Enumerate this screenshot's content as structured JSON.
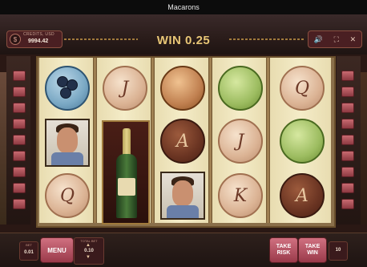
{
  "window": {
    "title": "Macarons"
  },
  "header": {
    "credits_label": "CREDITS, USD",
    "credits_value": "9994.42",
    "win_text": "WIN 0.25"
  },
  "settings": {
    "sound_icon": "sound-icon",
    "fullscreen_icon": "fullscreen-icon",
    "close_icon": "close-icon"
  },
  "reels": [
    [
      "macaron-blue-berry",
      "portrait-man",
      "macaron-cream-Q"
    ],
    [
      "macaron-cream-J",
      "champagne-bottle",
      "champagne-bottle"
    ],
    [
      "macaron-orange",
      "macaron-choco-A",
      "portrait-man"
    ],
    [
      "macaron-green-rose",
      "macaron-cream-J",
      "macaron-cream-K"
    ],
    [
      "macaron-cream-Q",
      "macaron-green-rose",
      "macaron-choco-A"
    ]
  ],
  "symbol_letters": {
    "J": "J",
    "Q": "Q",
    "A": "A",
    "K": "K"
  },
  "bottom": {
    "bet_label": "BET",
    "bet_value": "0.01",
    "menu_label": "MENU",
    "total_bet_label": "TOTAL BET",
    "total_bet_value": "0.10",
    "take_risk_line1": "TAKE",
    "take_risk_line2": "RISK",
    "take_win_line1": "TAKE",
    "take_win_line2": "WIN",
    "lines_value": "10"
  }
}
